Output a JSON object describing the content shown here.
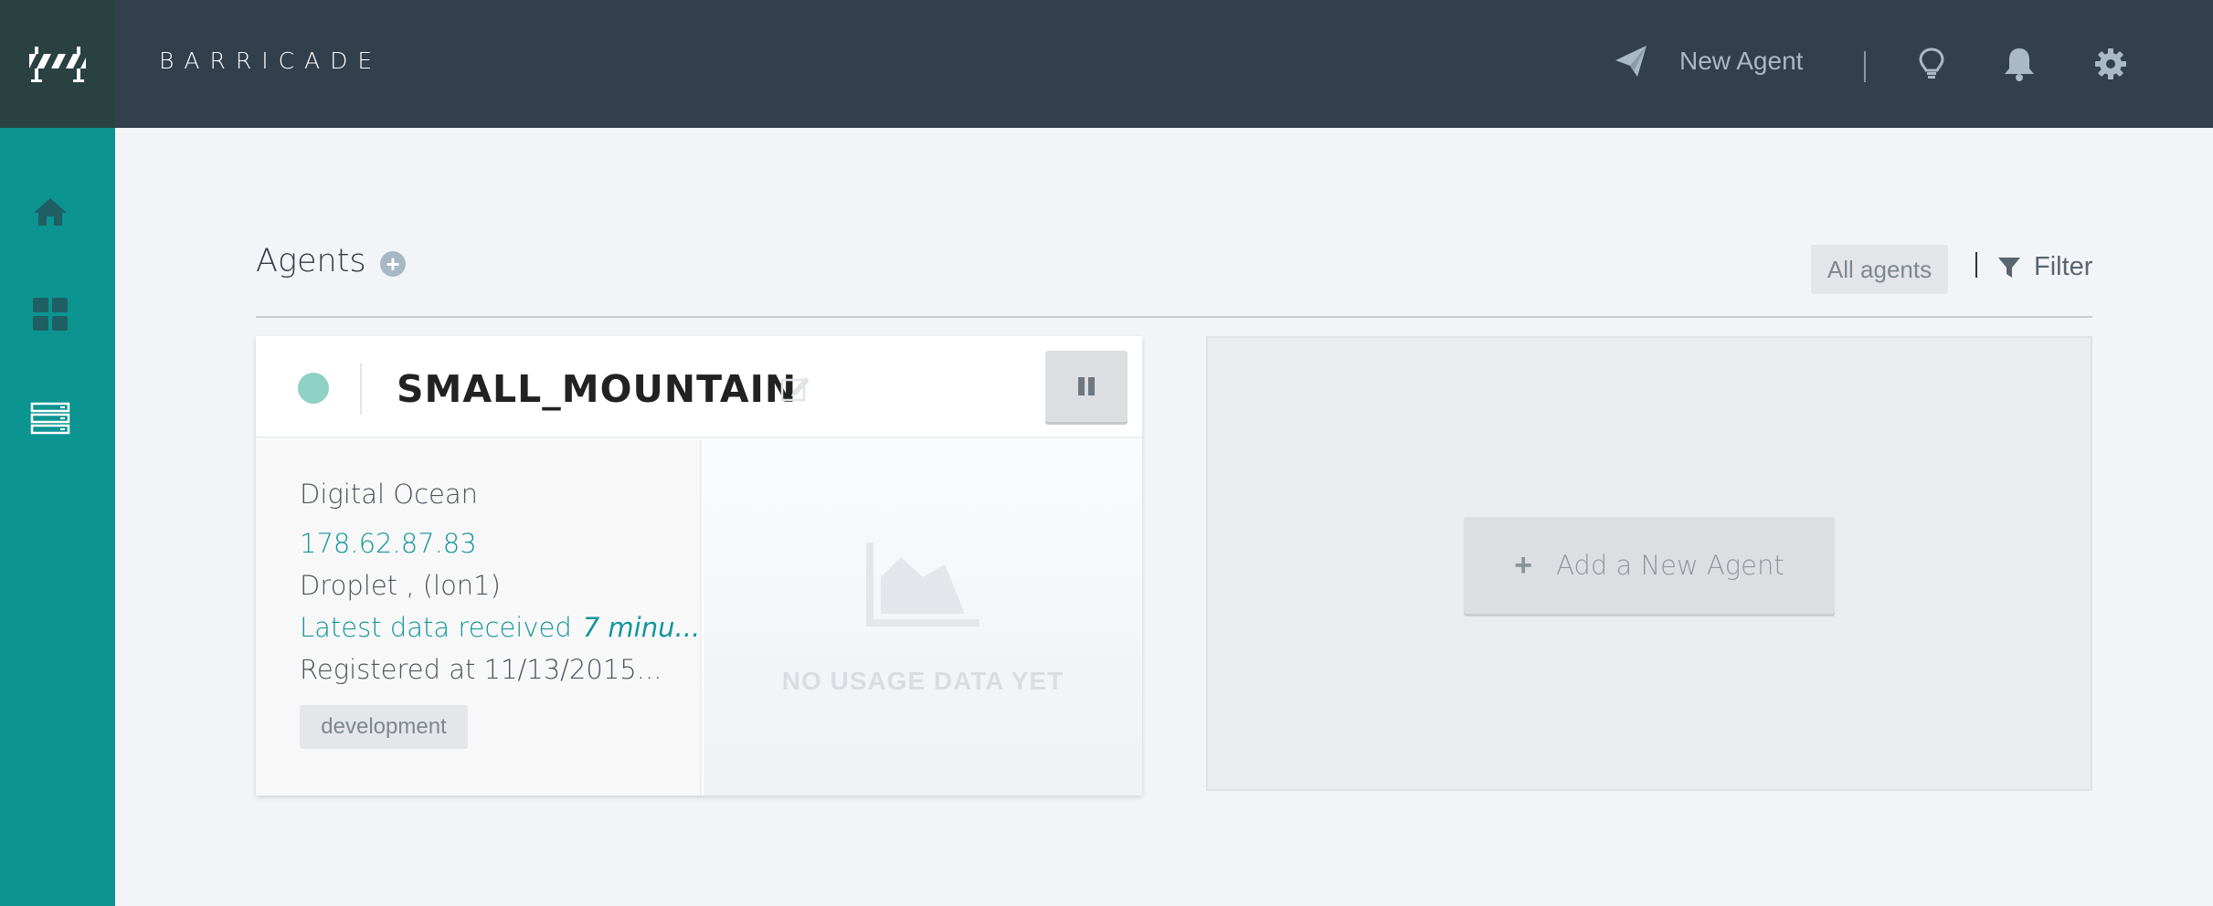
{
  "app": {
    "brand": "BARRICADE"
  },
  "header": {
    "new_agent_label": "New Agent",
    "icons": [
      "paper-plane-icon",
      "lightbulb-icon",
      "bell-icon",
      "gear-icon"
    ]
  },
  "sidebar": {
    "items": [
      {
        "name": "home",
        "icon": "home-icon"
      },
      {
        "name": "dashboard",
        "icon": "grid-icon"
      },
      {
        "name": "servers",
        "icon": "server-stack-icon"
      }
    ]
  },
  "main": {
    "title": "Agents",
    "filter_chip": "All agents",
    "filter_label": "Filter"
  },
  "agent": {
    "name": "SMALL_MOUNTAIN",
    "status_color": "#8fd1c4",
    "provider": "Digital Ocean",
    "ip": "178.62.87.83",
    "droplet": "Droplet , (lon1)",
    "latest_label": "Latest data received",
    "latest_value": "7 minu...",
    "registered": "Registered at 11/13/2015...",
    "tag": "development",
    "usage_empty": "NO USAGE DATA YET"
  },
  "placeholder": {
    "add_label": "Add a New Agent"
  },
  "colors": {
    "header_bg": "#323f4d",
    "sidebar_bg": "#0c9490",
    "accent_teal": "#14969a"
  }
}
